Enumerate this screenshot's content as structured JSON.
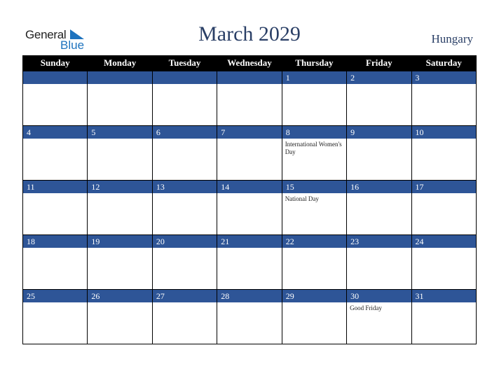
{
  "logo": {
    "text1": "General",
    "text2": "Blue"
  },
  "title": "March 2029",
  "country": "Hungary",
  "colors": {
    "header_bg": "#000000",
    "date_bar": "#2e5597",
    "title": "#2a3f66",
    "logo_blue": "#1e73be"
  },
  "weekdays": [
    "Sunday",
    "Monday",
    "Tuesday",
    "Wednesday",
    "Thursday",
    "Friday",
    "Saturday"
  ],
  "weeks": [
    [
      {
        "day": "",
        "event": ""
      },
      {
        "day": "",
        "event": ""
      },
      {
        "day": "",
        "event": ""
      },
      {
        "day": "",
        "event": ""
      },
      {
        "day": "1",
        "event": ""
      },
      {
        "day": "2",
        "event": ""
      },
      {
        "day": "3",
        "event": ""
      }
    ],
    [
      {
        "day": "4",
        "event": ""
      },
      {
        "day": "5",
        "event": ""
      },
      {
        "day": "6",
        "event": ""
      },
      {
        "day": "7",
        "event": ""
      },
      {
        "day": "8",
        "event": "International Women's Day"
      },
      {
        "day": "9",
        "event": ""
      },
      {
        "day": "10",
        "event": ""
      }
    ],
    [
      {
        "day": "11",
        "event": ""
      },
      {
        "day": "12",
        "event": ""
      },
      {
        "day": "13",
        "event": ""
      },
      {
        "day": "14",
        "event": ""
      },
      {
        "day": "15",
        "event": "National Day"
      },
      {
        "day": "16",
        "event": ""
      },
      {
        "day": "17",
        "event": ""
      }
    ],
    [
      {
        "day": "18",
        "event": ""
      },
      {
        "day": "19",
        "event": ""
      },
      {
        "day": "20",
        "event": ""
      },
      {
        "day": "21",
        "event": ""
      },
      {
        "day": "22",
        "event": ""
      },
      {
        "day": "23",
        "event": ""
      },
      {
        "day": "24",
        "event": ""
      }
    ],
    [
      {
        "day": "25",
        "event": ""
      },
      {
        "day": "26",
        "event": ""
      },
      {
        "day": "27",
        "event": ""
      },
      {
        "day": "28",
        "event": ""
      },
      {
        "day": "29",
        "event": ""
      },
      {
        "day": "30",
        "event": "Good Friday"
      },
      {
        "day": "31",
        "event": ""
      }
    ]
  ]
}
